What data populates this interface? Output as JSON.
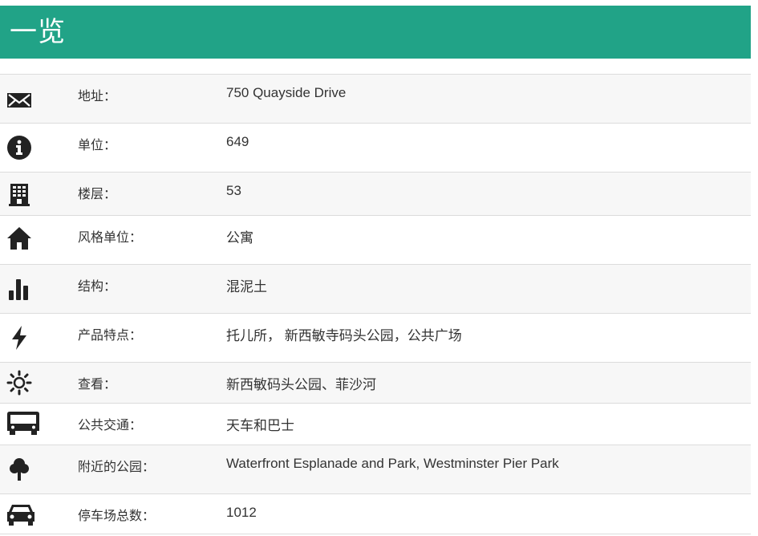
{
  "header": {
    "title": "一览"
  },
  "colors": {
    "header_bg": "#21a387",
    "row_alt": "#f7f7f7",
    "border": "#dcdcdc"
  },
  "rows": [
    {
      "icon": "envelope-icon",
      "label": "地址：",
      "value": "750 Quayside Drive"
    },
    {
      "icon": "info-icon",
      "label": "单位：",
      "value": "649"
    },
    {
      "icon": "building-icon",
      "label": "楼层：",
      "value": "53"
    },
    {
      "icon": "home-icon",
      "label": "风格单位：",
      "value": "公寓"
    },
    {
      "icon": "bar-chart-icon",
      "label": "结构：",
      "value": "混泥土"
    },
    {
      "icon": "lightning-icon",
      "label": "产品特点：",
      "value": "托儿所， 新西敏寺码头公园，公共广场"
    },
    {
      "icon": "sun-icon",
      "label": "查看：",
      "value": "新西敏码头公园、菲沙河"
    },
    {
      "icon": "bus-icon",
      "label": "公共交通：",
      "value": "天车和巴士"
    },
    {
      "icon": "tree-icon",
      "label": "附近的公园：",
      "value": "Waterfront Esplanade and Park, Westminster Pier Park"
    },
    {
      "icon": "car-icon",
      "label": "停车场总数：",
      "value": "1012"
    }
  ]
}
